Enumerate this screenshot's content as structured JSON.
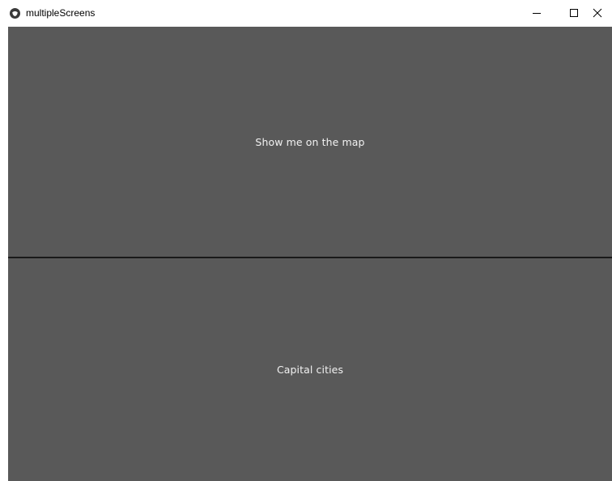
{
  "window": {
    "title": "multipleScreens",
    "controls": {
      "minimize_icon": "minimize-icon",
      "maximize_icon": "maximize-icon",
      "close_icon": "close-icon"
    }
  },
  "screens": {
    "top": {
      "label": "Show me on the map"
    },
    "bottom": {
      "label": "Capital cities"
    }
  },
  "colors": {
    "panel_background": "#595959",
    "divider": "#1a1a1a",
    "panel_text": "#f2f2f2",
    "titlebar_background": "#ffffff"
  }
}
